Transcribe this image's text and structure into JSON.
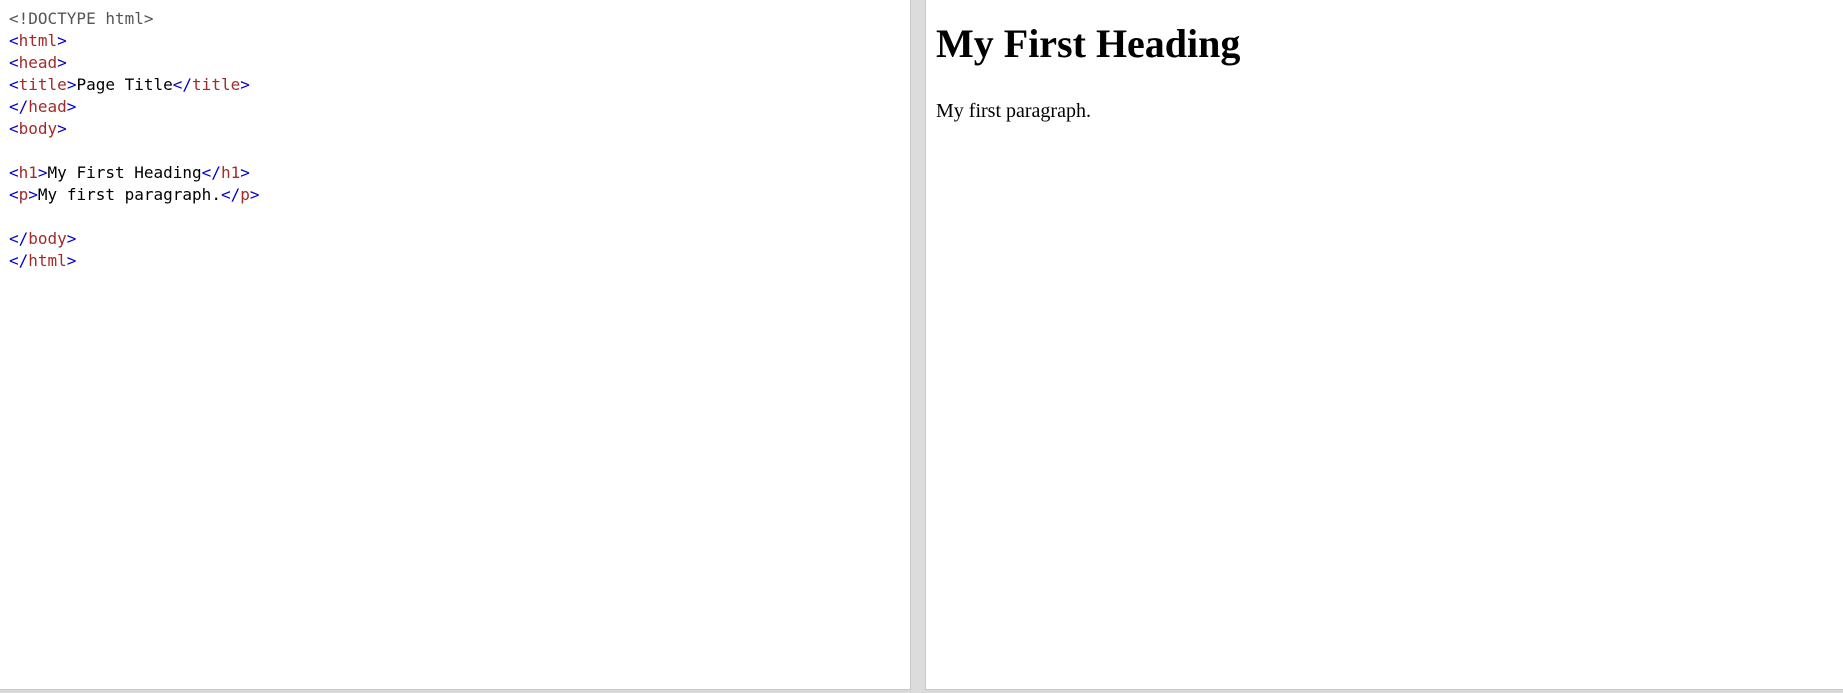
{
  "editor": {
    "lines": [
      {
        "segments": [
          {
            "type": "doctype",
            "text": "<!DOCTYPE html>"
          }
        ]
      },
      {
        "segments": [
          {
            "type": "bracket",
            "text": "<"
          },
          {
            "type": "tag",
            "text": "html"
          },
          {
            "type": "bracket",
            "text": ">"
          }
        ]
      },
      {
        "segments": [
          {
            "type": "bracket",
            "text": "<"
          },
          {
            "type": "tag",
            "text": "head"
          },
          {
            "type": "bracket",
            "text": ">"
          }
        ]
      },
      {
        "segments": [
          {
            "type": "bracket",
            "text": "<"
          },
          {
            "type": "tag",
            "text": "title"
          },
          {
            "type": "bracket",
            "text": ">"
          },
          {
            "type": "text",
            "text": "Page Title"
          },
          {
            "type": "bracket",
            "text": "</"
          },
          {
            "type": "tag",
            "text": "title"
          },
          {
            "type": "bracket",
            "text": ">"
          }
        ]
      },
      {
        "segments": [
          {
            "type": "bracket",
            "text": "</"
          },
          {
            "type": "tag",
            "text": "head"
          },
          {
            "type": "bracket",
            "text": ">"
          }
        ]
      },
      {
        "segments": [
          {
            "type": "bracket",
            "text": "<"
          },
          {
            "type": "tag",
            "text": "body"
          },
          {
            "type": "bracket",
            "text": ">"
          }
        ]
      },
      {
        "segments": []
      },
      {
        "segments": [
          {
            "type": "bracket",
            "text": "<"
          },
          {
            "type": "tag",
            "text": "h1"
          },
          {
            "type": "bracket",
            "text": ">"
          },
          {
            "type": "text",
            "text": "My First Heading"
          },
          {
            "type": "bracket",
            "text": "</"
          },
          {
            "type": "tag",
            "text": "h1"
          },
          {
            "type": "bracket",
            "text": ">"
          }
        ]
      },
      {
        "segments": [
          {
            "type": "bracket",
            "text": "<"
          },
          {
            "type": "tag",
            "text": "p"
          },
          {
            "type": "bracket",
            "text": ">"
          },
          {
            "type": "text",
            "text": "My first paragraph."
          },
          {
            "type": "bracket",
            "text": "</"
          },
          {
            "type": "tag",
            "text": "p"
          },
          {
            "type": "bracket",
            "text": ">"
          }
        ]
      },
      {
        "segments": []
      },
      {
        "segments": [
          {
            "type": "bracket",
            "text": "</"
          },
          {
            "type": "tag",
            "text": "body"
          },
          {
            "type": "bracket",
            "text": ">"
          }
        ]
      },
      {
        "segments": [
          {
            "type": "bracket",
            "text": "</"
          },
          {
            "type": "tag",
            "text": "html"
          },
          {
            "type": "bracket",
            "text": ">"
          }
        ]
      }
    ]
  },
  "result": {
    "heading": "My First Heading",
    "paragraph": "My first paragraph."
  },
  "colors": {
    "doctype": "#555555",
    "bracket": "#0000cd",
    "tag": "#a52a2a",
    "text": "#000000",
    "divider": "#dcdcdc"
  }
}
